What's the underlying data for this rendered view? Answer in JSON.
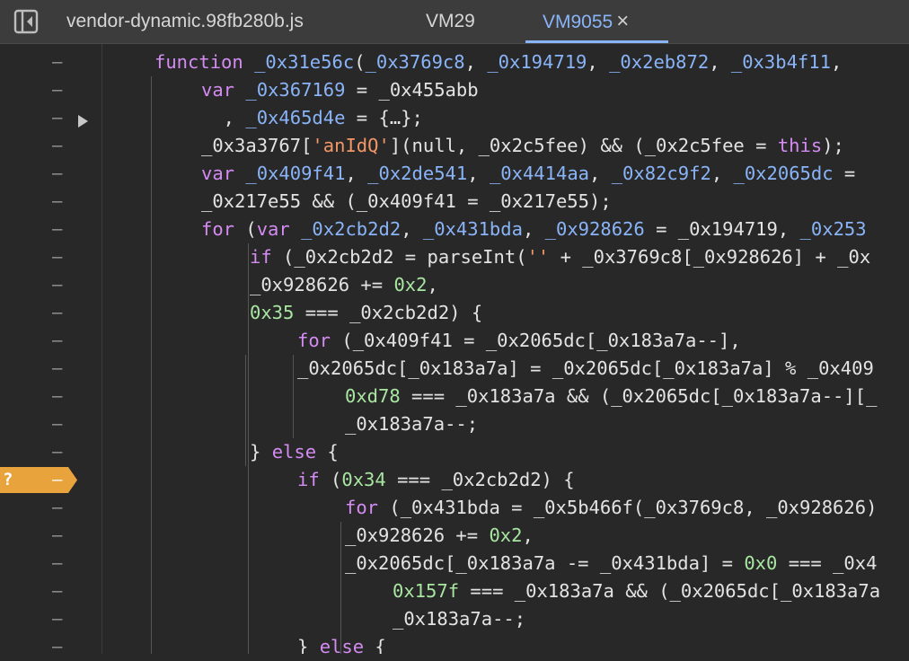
{
  "tabs": [
    {
      "label": "vendor-dynamic.98fb280b.js"
    },
    {
      "label": "VM29"
    },
    {
      "label": "VM9055",
      "active": true,
      "close_icon": "×"
    }
  ],
  "gutter": {
    "dash": "–",
    "breakpoint": {
      "label": "?",
      "line_index": 15,
      "color": "#e8a33d"
    },
    "collapsed_line_index": 2
  },
  "colors": {
    "keyword": "#d48bf2",
    "variable": "#8ab4f8",
    "string": "#f29766",
    "number": "#a8e6a1",
    "plain": "#e3e3e3",
    "active_tab": "#8ab4f8"
  },
  "code_lines": [
    [
      {
        "t": "kw",
        "v": "function"
      },
      {
        "t": "pl",
        "v": " "
      },
      {
        "t": "vr",
        "v": "_0x31e56c"
      },
      {
        "t": "pl",
        "v": "("
      },
      {
        "t": "vr",
        "v": "_0x3769c8"
      },
      {
        "t": "pl",
        "v": ", "
      },
      {
        "t": "vr",
        "v": "_0x194719"
      },
      {
        "t": "pl",
        "v": ", "
      },
      {
        "t": "vr",
        "v": "_0x2eb872"
      },
      {
        "t": "pl",
        "v": ", "
      },
      {
        "t": "vr",
        "v": "_0x3b4f11"
      },
      {
        "t": "pl",
        "v": ", "
      }
    ],
    [
      {
        "t": "kw",
        "v": "var"
      },
      {
        "t": "pl",
        "v": " "
      },
      {
        "t": "vr",
        "v": "_0x367169"
      },
      {
        "t": "pl",
        "v": " = _0x455abb"
      }
    ],
    [
      {
        "t": "pl",
        "v": "  , "
      },
      {
        "t": "vr",
        "v": "_0x465d4e"
      },
      {
        "t": "pl",
        "v": " = {…};"
      }
    ],
    [
      {
        "t": "pl",
        "v": "_0x3a3767["
      },
      {
        "t": "st",
        "v": "'anIdQ'"
      },
      {
        "t": "pl",
        "v": "](null, _0x2c5fee) && (_0x2c5fee = "
      },
      {
        "t": "kw",
        "v": "this"
      },
      {
        "t": "pl",
        "v": ");"
      }
    ],
    [
      {
        "t": "kw",
        "v": "var"
      },
      {
        "t": "pl",
        "v": " "
      },
      {
        "t": "vr",
        "v": "_0x409f41"
      },
      {
        "t": "pl",
        "v": ", "
      },
      {
        "t": "vr",
        "v": "_0x2de541"
      },
      {
        "t": "pl",
        "v": ", "
      },
      {
        "t": "vr",
        "v": "_0x4414aa"
      },
      {
        "t": "pl",
        "v": ", "
      },
      {
        "t": "vr",
        "v": "_0x82c9f2"
      },
      {
        "t": "pl",
        "v": ", "
      },
      {
        "t": "vr",
        "v": "_0x2065dc"
      },
      {
        "t": "pl",
        "v": " ="
      }
    ],
    [
      {
        "t": "pl",
        "v": "_0x217e55 && (_0x409f41 = _0x217e55);"
      }
    ],
    [
      {
        "t": "kw",
        "v": "for"
      },
      {
        "t": "pl",
        "v": " ("
      },
      {
        "t": "kw",
        "v": "var"
      },
      {
        "t": "pl",
        "v": " "
      },
      {
        "t": "vr",
        "v": "_0x2cb2d2"
      },
      {
        "t": "pl",
        "v": ", "
      },
      {
        "t": "vr",
        "v": "_0x431bda"
      },
      {
        "t": "pl",
        "v": ", "
      },
      {
        "t": "vr",
        "v": "_0x928626"
      },
      {
        "t": "pl",
        "v": " = _0x194719, "
      },
      {
        "t": "vr",
        "v": "_0x253"
      }
    ],
    [
      {
        "t": "kw",
        "v": "if"
      },
      {
        "t": "pl",
        "v": " (_0x2cb2d2 = parseInt("
      },
      {
        "t": "st",
        "v": "''"
      },
      {
        "t": "pl",
        "v": " + _0x3769c8[_0x928626] + _0x"
      }
    ],
    [
      {
        "t": "pl",
        "v": "_0x928626 += "
      },
      {
        "t": "nm",
        "v": "0x2"
      },
      {
        "t": "pl",
        "v": ","
      }
    ],
    [
      {
        "t": "nm",
        "v": "0x35"
      },
      {
        "t": "pl",
        "v": " === _0x2cb2d2) {"
      }
    ],
    [
      {
        "t": "kw",
        "v": "for"
      },
      {
        "t": "pl",
        "v": " (_0x409f41 = _0x2065dc[_0x183a7a--],"
      }
    ],
    [
      {
        "t": "pl",
        "v": "_0x2065dc[_0x183a7a] = _0x2065dc[_0x183a7a] % _0x409"
      }
    ],
    [
      {
        "t": "nm",
        "v": "0xd78"
      },
      {
        "t": "pl",
        "v": " === _0x183a7a && (_0x2065dc[_0x183a7a--][_"
      }
    ],
    [
      {
        "t": "pl",
        "v": "_0x183a7a--;"
      }
    ],
    [
      {
        "t": "pl",
        "v": "} "
      },
      {
        "t": "kw",
        "v": "else"
      },
      {
        "t": "pl",
        "v": " {"
      }
    ],
    [
      {
        "t": "kw",
        "v": "if"
      },
      {
        "t": "pl",
        "v": " ("
      },
      {
        "t": "nm",
        "v": "0x34"
      },
      {
        "t": "pl",
        "v": " === _0x2cb2d2) {"
      }
    ],
    [
      {
        "t": "kw",
        "v": "for"
      },
      {
        "t": "pl",
        "v": " (_0x431bda = _0x5b466f(_0x3769c8, _0x928626)"
      }
    ],
    [
      {
        "t": "pl",
        "v": "_0x928626 += "
      },
      {
        "t": "nm",
        "v": "0x2"
      },
      {
        "t": "pl",
        "v": ","
      }
    ],
    [
      {
        "t": "pl",
        "v": "_0x2065dc[_0x183a7a -= _0x431bda] = "
      },
      {
        "t": "nm",
        "v": "0x0"
      },
      {
        "t": "pl",
        "v": " === _0x4"
      }
    ],
    [
      {
        "t": "nm",
        "v": "0x157f"
      },
      {
        "t": "pl",
        "v": " === _0x183a7a && (_0x2065dc[_0x183a7a"
      }
    ],
    [
      {
        "t": "pl",
        "v": "_0x183a7a--;"
      }
    ],
    [
      {
        "t": "pl",
        "v": "} "
      },
      {
        "t": "kw",
        "v": "else"
      },
      {
        "t": "pl",
        "v": " {"
      }
    ]
  ]
}
